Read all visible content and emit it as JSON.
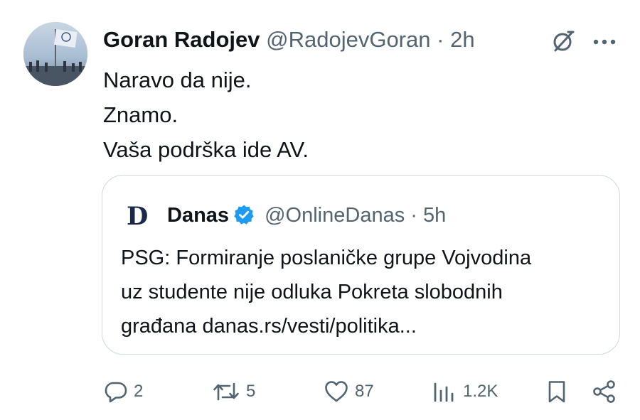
{
  "tweet": {
    "author": {
      "name": "Goran Radojev",
      "handle": "@RadojevGoran",
      "separator": "·",
      "time": "2h"
    },
    "text_lines": [
      "Naravo da nije.",
      "Znamo.",
      "Vaša podrška ide AV."
    ],
    "icons": {
      "grok": "grok-icon",
      "more": "more-icon"
    }
  },
  "quote": {
    "logo_letter": "D",
    "name": "Danas",
    "verified_color": "#1d9bf0",
    "handle": "@OnlineDanas",
    "separator": "·",
    "time": "5h",
    "text_lines": [
      "PSG: Formiranje poslaničke grupe Vojvodina",
      "uz studente nije odluka Pokreta slobodnih",
      "građana danas.rs/vesti/politika..."
    ]
  },
  "actions": {
    "reply_count": "2",
    "repost_count": "5",
    "like_count": "87",
    "views_count": "1.2K"
  },
  "colors": {
    "text": "#0f1419",
    "secondary": "#536471",
    "border": "#cfd9de",
    "accent": "#1d9bf0"
  }
}
